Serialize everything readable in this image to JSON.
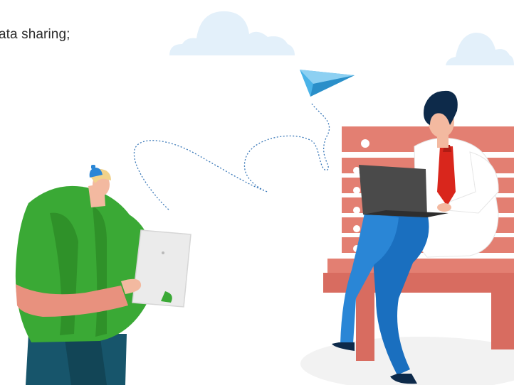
{
  "caption": {
    "text": "ata sharing;"
  },
  "illustration": {
    "icons": [
      "cloud-icon",
      "paper-plane-icon",
      "tablet-icon",
      "laptop-icon",
      "bench-icon"
    ],
    "colors": {
      "cloud": "#e3f0fa",
      "plane": "#4ab3e8",
      "trail": "#3a78b8",
      "shirt_green": "#3aa935",
      "skin": "#f3b9a0",
      "bench": "#e37f72",
      "jeans": "#1a6fbf",
      "tie": "#d9261c",
      "laptop": "#4a4a4a",
      "hair": "#0d2a4a",
      "shadow": "#f0f0f0"
    }
  }
}
